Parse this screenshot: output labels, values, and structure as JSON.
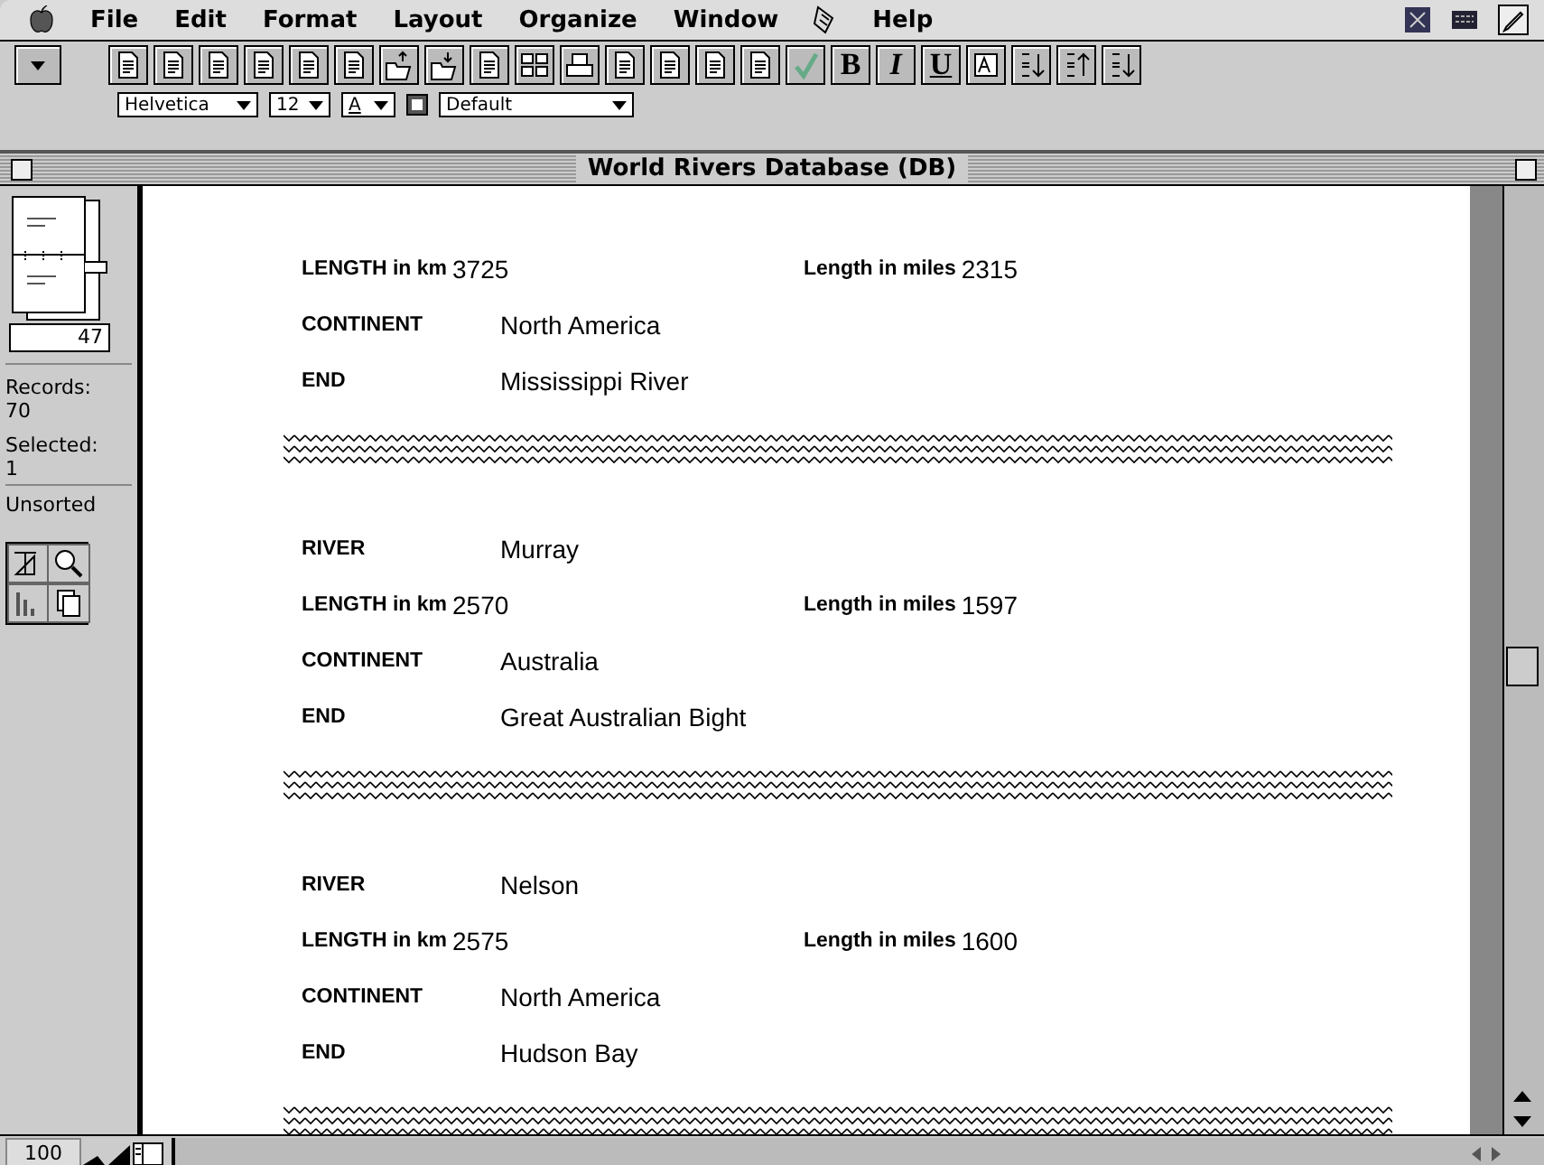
{
  "menu_bar": {
    "items": [
      "File",
      "Edit",
      "Format",
      "Layout",
      "Organize",
      "Window",
      "Help"
    ]
  },
  "toolbar": {
    "style_buttons": [
      "B",
      "I",
      "U"
    ]
  },
  "format_bar": {
    "font": "Helvetica",
    "size": "12",
    "text_color": "A",
    "style": "Default"
  },
  "window": {
    "title": "World Rivers Database (DB)"
  },
  "sidebar": {
    "record_number": "47",
    "records_label": "Records:",
    "records_count": "70",
    "selected_label": "Selected:",
    "selected_count": "1",
    "sort_state": "Unsorted"
  },
  "records": [
    {
      "rows": [
        {
          "label": "LENGTH in km",
          "value": "3725",
          "extra_label": "Length in miles",
          "extra_value": "2315"
        },
        {
          "label": "CONTINENT",
          "value": "North America"
        },
        {
          "label": "END",
          "value": "Mississippi River"
        }
      ]
    },
    {
      "rows": [
        {
          "label": "RIVER",
          "value": "Murray"
        },
        {
          "label": "LENGTH in km",
          "value": "2570",
          "extra_label": "Length in miles",
          "extra_value": "1597"
        },
        {
          "label": "CONTINENT",
          "value": "Australia"
        },
        {
          "label": "END",
          "value": "Great Australian Bight"
        }
      ]
    },
    {
      "rows": [
        {
          "label": "RIVER",
          "value": "Nelson"
        },
        {
          "label": "LENGTH in km",
          "value": "2575",
          "extra_label": "Length in miles",
          "extra_value": "1600"
        },
        {
          "label": "CONTINENT",
          "value": "North America"
        },
        {
          "label": "END",
          "value": "Hudson Bay"
        }
      ]
    }
  ],
  "status_bar": {
    "zoom": "100"
  }
}
